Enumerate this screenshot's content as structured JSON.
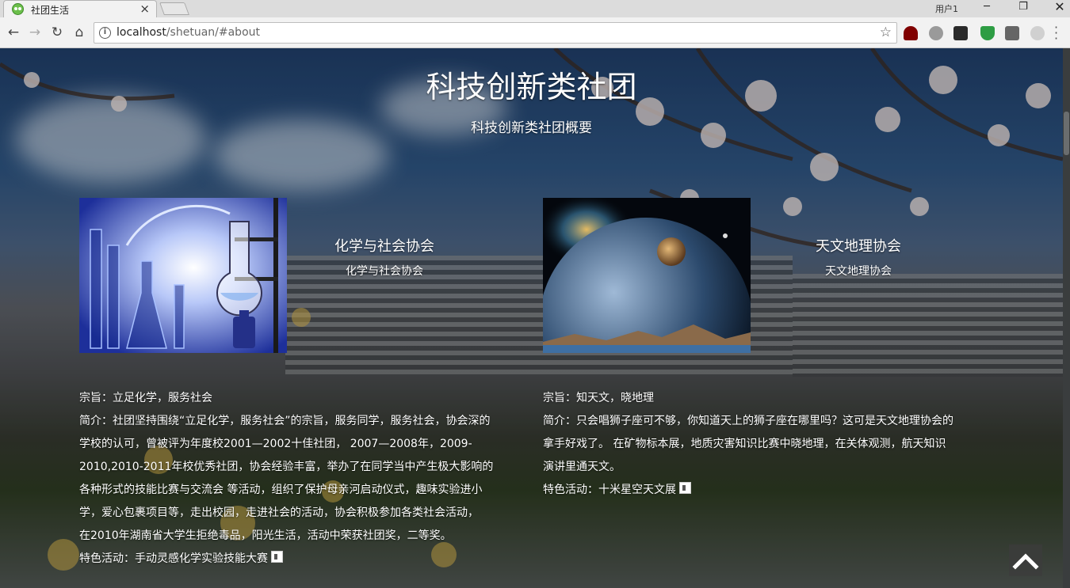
{
  "browser": {
    "tab_title": "社团生活",
    "tab_close": "×",
    "profile_label": "用户1",
    "url_host": "localhost",
    "url_path": "/shetuan/#about"
  },
  "page": {
    "heading": "科技创新类社团",
    "subheading": "科技创新类社团概要",
    "clubs": [
      {
        "title": "化学与社会协会",
        "subtitle": "化学与社会协会",
        "image_icon": "lab-flask-image",
        "lines": [
          "宗旨：立足化学，服务社会",
          "简介：社团坚持围绕“立足化学，服务社会”的宗旨，服务同学，服务社会，协会深的",
          "学校的认可，曾被评为年度校2001—2002十佳社团， 2007—2008年，2009-",
          "2010,2010-2011年校优秀社团，协会经验丰富，举办了在同学当中产生极大影响的",
          "各种形式的技能比赛与交流会 等活动，组织了保护母亲河启动仪式，趣味实验进小",
          "学，爱心包裹项目等，走出校园，走进社会的活动，协会积极参加各类社会活动，",
          "在2010年湖南省大学生拒绝毒品，阳光生活，活动中荣获社团奖，二等奖。"
        ],
        "feature": "特色活动：手动灵感化学实验技能大赛"
      },
      {
        "title": "天文地理协会",
        "subtitle": "天文地理协会",
        "image_icon": "planet-image",
        "lines": [
          "宗旨：知天文，晓地理",
          "简介：只会唱狮子座可不够，你知道天上的狮子座在哪里吗？这可是天文地理协会的",
          "拿手好戏了。 在矿物标本展，地质灾害知识比赛中晓地理，在关体观测，航天知识",
          "演讲里通天文。"
        ],
        "feature": "特色活动：十米星空天文展"
      }
    ]
  },
  "icons": {
    "back": "back-arrow-icon",
    "forward": "forward-arrow-icon",
    "reload": "reload-icon",
    "home": "home-icon",
    "bookmark": "star-icon",
    "sound": "sound-icon",
    "back_to_top": "chevron-up-icon"
  }
}
